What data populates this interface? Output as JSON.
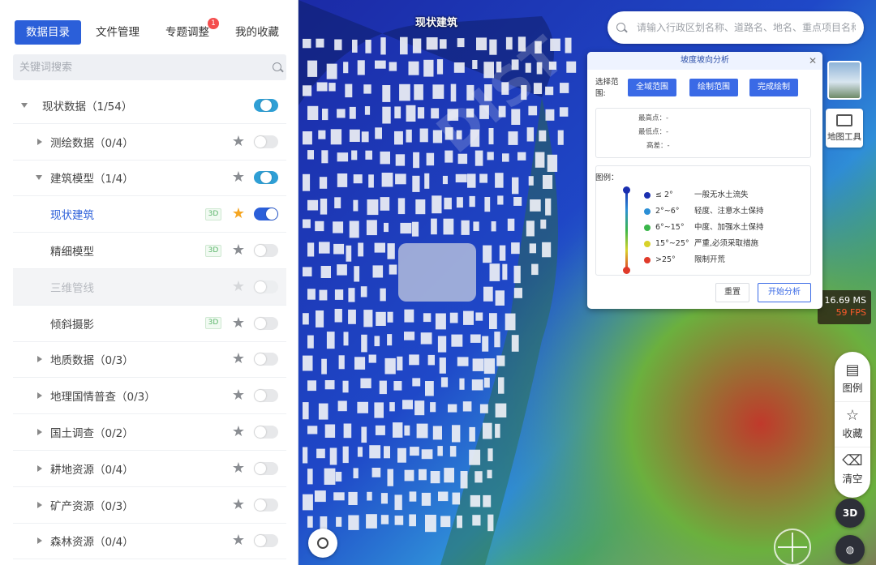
{
  "tabs": [
    {
      "label": "数据目录"
    },
    {
      "label": "文件管理"
    },
    {
      "label": "专题调整",
      "badge": "1"
    },
    {
      "label": "我的收藏"
    }
  ],
  "search": {
    "placeholder": "关键词搜索"
  },
  "tree": [
    {
      "label": "现状数据（1/54）",
      "level": 0,
      "arrow": "down",
      "tag": "",
      "star": "none",
      "toggle": "half"
    },
    {
      "label": "测绘数据（0/4）",
      "level": 1,
      "arrow": "right",
      "tag": "",
      "star": "off",
      "toggle": "off"
    },
    {
      "label": "建筑模型（1/4）",
      "level": 1,
      "arrow": "down",
      "tag": "",
      "star": "off",
      "toggle": "half"
    },
    {
      "label": "现状建筑",
      "level": 2,
      "arrow": "",
      "tag": "3D",
      "star": "on",
      "toggle": "on",
      "selected": true
    },
    {
      "label": "精细模型",
      "level": 2,
      "arrow": "",
      "tag": "3D",
      "star": "off",
      "toggle": "off"
    },
    {
      "label": "三维管线",
      "level": 2,
      "arrow": "",
      "tag": "",
      "star": "faint",
      "toggle": "dim",
      "disabled": true
    },
    {
      "label": "倾斜摄影",
      "level": 2,
      "arrow": "",
      "tag": "3D",
      "star": "off",
      "toggle": "off"
    },
    {
      "label": "地质数据（0/3）",
      "level": 1,
      "arrow": "right",
      "tag": "",
      "star": "off",
      "toggle": "off"
    },
    {
      "label": "地理国情普查（0/3）",
      "level": 1,
      "arrow": "right",
      "tag": "",
      "star": "off",
      "toggle": "off"
    },
    {
      "label": "国土调查（0/2）",
      "level": 1,
      "arrow": "right",
      "tag": "",
      "star": "off",
      "toggle": "off"
    },
    {
      "label": "耕地资源（0/4）",
      "level": 1,
      "arrow": "right",
      "tag": "",
      "star": "off",
      "toggle": "off"
    },
    {
      "label": "矿产资源（0/3）",
      "level": 1,
      "arrow": "right",
      "tag": "",
      "star": "off",
      "toggle": "off"
    },
    {
      "label": "森林资源（0/4）",
      "level": 1,
      "arrow": "right",
      "tag": "",
      "star": "off",
      "toggle": "off"
    }
  ],
  "map": {
    "layer_title": "现状建筑",
    "search_placeholder": "请输入行政区划名称、道路名、地名、重点项目名称、许",
    "map_tool_label": "地图工具",
    "perf_ms": "16.69 MS",
    "perf_fps": "59 FPS",
    "side_buttons": [
      {
        "label": "图例",
        "icon": "legend-icon",
        "glyph": "▤"
      },
      {
        "label": "收藏",
        "icon": "star-icon",
        "glyph": "☆"
      },
      {
        "label": "清空",
        "icon": "clear-icon",
        "glyph": "⌫"
      }
    ],
    "btn_3d": "3D",
    "watermark": "DIST"
  },
  "analysis_panel": {
    "title": "坡度坡向分析",
    "range_label": "选择范围:",
    "buttons": [
      "全域范围",
      "绘制范围",
      "完成绘制"
    ],
    "info": [
      {
        "label": "最高点：",
        "value": "-"
      },
      {
        "label": "最低点：",
        "value": "-"
      },
      {
        "label": "高差：",
        "value": "-"
      }
    ],
    "legend_title": "图例：",
    "legend": [
      {
        "range": "≤ 2°",
        "desc": "一般无水土流失",
        "color": "#1a2fb0"
      },
      {
        "range": "2°~6°",
        "desc": "轻度、注意水土保持",
        "color": "#2b8fd6"
      },
      {
        "range": "6°~15°",
        "desc": "中度、加强水土保持",
        "color": "#3ab64a"
      },
      {
        "range": "15°~25°",
        "desc": "严重,必须采取措施",
        "color": "#d8d22a"
      },
      {
        "range": ">25°",
        "desc": "限制开荒",
        "color": "#e03a2a"
      }
    ],
    "reset_label": "重置",
    "start_label": "开始分析"
  },
  "colors": {
    "accent": "#2b5fd9",
    "star_active": "#f5a623",
    "fps_red": "#ff5a2a"
  }
}
